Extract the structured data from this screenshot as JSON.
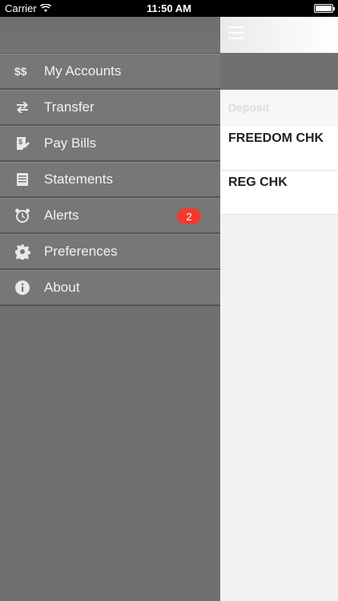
{
  "status_bar": {
    "carrier": "Carrier",
    "time": "11:50 AM"
  },
  "menu": {
    "items": [
      {
        "label": "My Accounts",
        "icon": "dollar-icon"
      },
      {
        "label": "Transfer",
        "icon": "transfer-icon"
      },
      {
        "label": "Pay Bills",
        "icon": "bill-icon"
      },
      {
        "label": "Statements",
        "icon": "statement-icon"
      },
      {
        "label": "Alerts",
        "icon": "alarm-clock-icon",
        "badge": "2"
      },
      {
        "label": "Preferences",
        "icon": "gear-icon"
      },
      {
        "label": "About",
        "icon": "info-icon"
      }
    ]
  },
  "main": {
    "section_label": "Deposit",
    "accounts": [
      "FREEDOM CHK",
      "REG CHK"
    ]
  },
  "colors": {
    "badge": "#f13a2f",
    "drawer_bg": "#6f6f6f"
  }
}
